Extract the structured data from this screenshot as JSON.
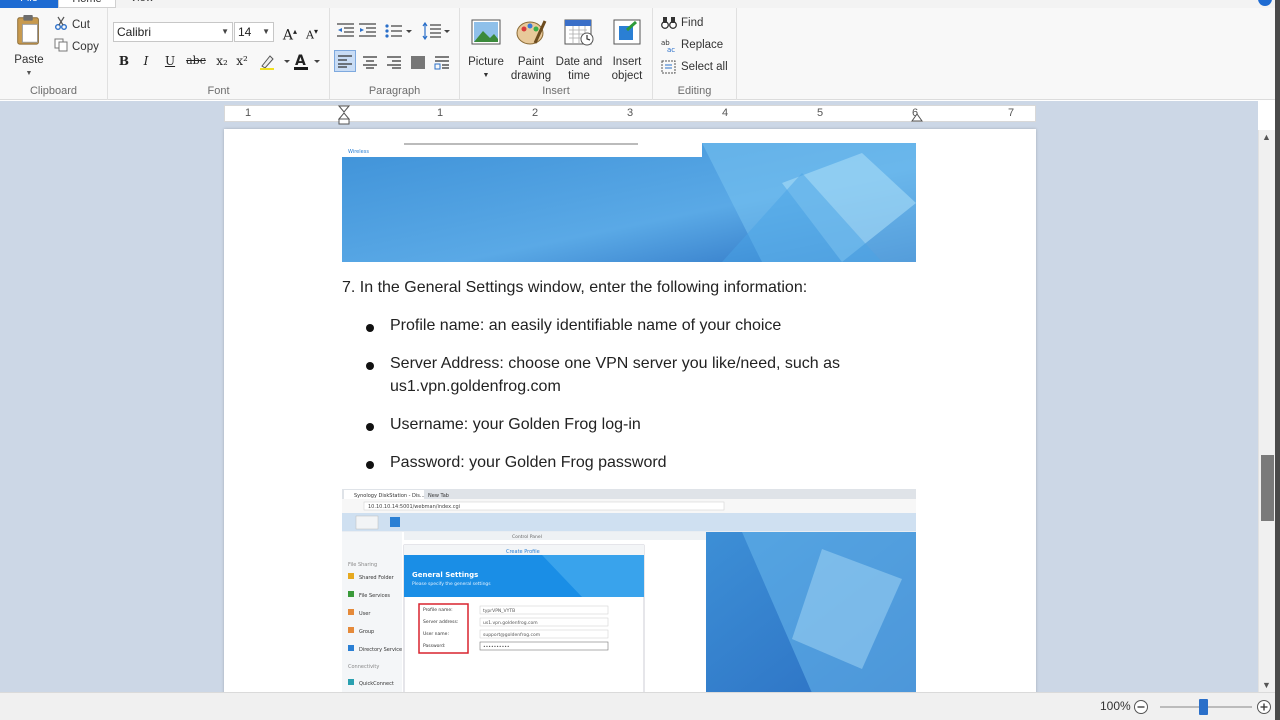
{
  "tabs": {
    "file": "File",
    "home": "Home",
    "view": "View"
  },
  "clipboard": {
    "paste": "Paste",
    "cut": "Cut",
    "copy": "Copy",
    "label": "Clipboard"
  },
  "font": {
    "family": "Calibri",
    "size": "14",
    "label": "Font",
    "bold": "B",
    "italic": "I",
    "underline": "U",
    "strike": "abc",
    "subscript": "x₂",
    "superscript": "x²"
  },
  "paragraph": {
    "label": "Paragraph"
  },
  "insert": {
    "picture": "Picture",
    "paint_l1": "Paint",
    "paint_l2": "drawing",
    "datetime_l1": "Date and",
    "datetime_l2": "time",
    "object_l1": "Insert",
    "object_l2": "object",
    "label": "Insert"
  },
  "editing": {
    "find": "Find",
    "replace": "Replace",
    "select_all": "Select all",
    "label": "Editing"
  },
  "ruler": {
    "numbers": [
      "1",
      "1",
      "2",
      "3",
      "4",
      "5",
      "6",
      "7"
    ]
  },
  "document": {
    "step": "7. In the General Settings window, enter the following information:",
    "bullets": [
      {
        "line1": "Profile name: an easily identifiable name of your choice",
        "line2": ""
      },
      {
        "line1": "Server Address: choose one VPN server you like/need, such as",
        "line2": "us1.vpn.goldenfrog.com"
      },
      {
        "line1": "Username: your Golden Frog log-in",
        "line2": ""
      },
      {
        "line1": "Password: your Golden Frog password",
        "line2": ""
      }
    ]
  },
  "screenshot": {
    "top_label": "Wireless",
    "tab1": "Synology DiskStation - Dis...",
    "tab2": "New Tab",
    "url": "10.10.10.14:5001/webman/index.cgi",
    "dialog_title": "Create Profile",
    "header_title": "General Settings",
    "header_sub": "Please specify the general settings",
    "fields": [
      {
        "label": "Profile name:",
        "value": "typrVPN_VYTB"
      },
      {
        "label": "Server address:",
        "value": "us1.vpn.goldenfrog.com"
      },
      {
        "label": "User name:",
        "value": "support@goldenfrog.com"
      },
      {
        "label": "Password:",
        "value": "••••••••••"
      }
    ],
    "sidebar": [
      "File Sharing",
      "Shared Folder",
      "File Services",
      "User",
      "Group",
      "Directory Service",
      "Connectivity",
      "QuickConnect"
    ],
    "panel_title": "Control Panel"
  },
  "status": {
    "zoom": "100%"
  },
  "colors": {
    "accent": "#1e6bd2",
    "workspace": "#ccd7e6",
    "highlight_box": "#d9232e"
  }
}
